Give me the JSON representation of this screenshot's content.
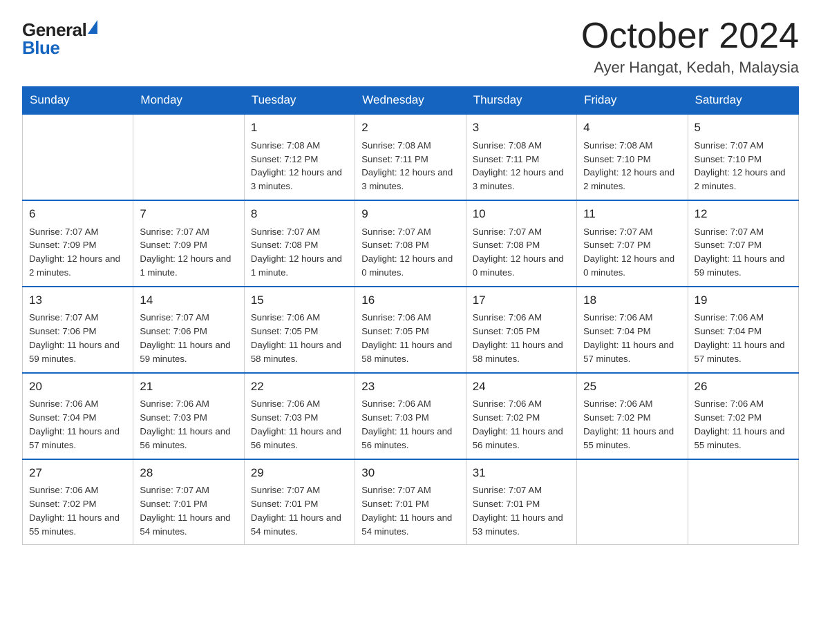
{
  "header": {
    "logo_general": "General",
    "logo_blue": "Blue",
    "month_title": "October 2024",
    "location": "Ayer Hangat, Kedah, Malaysia"
  },
  "days_of_week": [
    "Sunday",
    "Monday",
    "Tuesday",
    "Wednesday",
    "Thursday",
    "Friday",
    "Saturday"
  ],
  "weeks": [
    [
      {
        "day": "",
        "info": ""
      },
      {
        "day": "",
        "info": ""
      },
      {
        "day": "1",
        "info": "Sunrise: 7:08 AM\nSunset: 7:12 PM\nDaylight: 12 hours\nand 3 minutes."
      },
      {
        "day": "2",
        "info": "Sunrise: 7:08 AM\nSunset: 7:11 PM\nDaylight: 12 hours\nand 3 minutes."
      },
      {
        "day": "3",
        "info": "Sunrise: 7:08 AM\nSunset: 7:11 PM\nDaylight: 12 hours\nand 3 minutes."
      },
      {
        "day": "4",
        "info": "Sunrise: 7:08 AM\nSunset: 7:10 PM\nDaylight: 12 hours\nand 2 minutes."
      },
      {
        "day": "5",
        "info": "Sunrise: 7:07 AM\nSunset: 7:10 PM\nDaylight: 12 hours\nand 2 minutes."
      }
    ],
    [
      {
        "day": "6",
        "info": "Sunrise: 7:07 AM\nSunset: 7:09 PM\nDaylight: 12 hours\nand 2 minutes."
      },
      {
        "day": "7",
        "info": "Sunrise: 7:07 AM\nSunset: 7:09 PM\nDaylight: 12 hours\nand 1 minute."
      },
      {
        "day": "8",
        "info": "Sunrise: 7:07 AM\nSunset: 7:08 PM\nDaylight: 12 hours\nand 1 minute."
      },
      {
        "day": "9",
        "info": "Sunrise: 7:07 AM\nSunset: 7:08 PM\nDaylight: 12 hours\nand 0 minutes."
      },
      {
        "day": "10",
        "info": "Sunrise: 7:07 AM\nSunset: 7:08 PM\nDaylight: 12 hours\nand 0 minutes."
      },
      {
        "day": "11",
        "info": "Sunrise: 7:07 AM\nSunset: 7:07 PM\nDaylight: 12 hours\nand 0 minutes."
      },
      {
        "day": "12",
        "info": "Sunrise: 7:07 AM\nSunset: 7:07 PM\nDaylight: 11 hours\nand 59 minutes."
      }
    ],
    [
      {
        "day": "13",
        "info": "Sunrise: 7:07 AM\nSunset: 7:06 PM\nDaylight: 11 hours\nand 59 minutes."
      },
      {
        "day": "14",
        "info": "Sunrise: 7:07 AM\nSunset: 7:06 PM\nDaylight: 11 hours\nand 59 minutes."
      },
      {
        "day": "15",
        "info": "Sunrise: 7:06 AM\nSunset: 7:05 PM\nDaylight: 11 hours\nand 58 minutes."
      },
      {
        "day": "16",
        "info": "Sunrise: 7:06 AM\nSunset: 7:05 PM\nDaylight: 11 hours\nand 58 minutes."
      },
      {
        "day": "17",
        "info": "Sunrise: 7:06 AM\nSunset: 7:05 PM\nDaylight: 11 hours\nand 58 minutes."
      },
      {
        "day": "18",
        "info": "Sunrise: 7:06 AM\nSunset: 7:04 PM\nDaylight: 11 hours\nand 57 minutes."
      },
      {
        "day": "19",
        "info": "Sunrise: 7:06 AM\nSunset: 7:04 PM\nDaylight: 11 hours\nand 57 minutes."
      }
    ],
    [
      {
        "day": "20",
        "info": "Sunrise: 7:06 AM\nSunset: 7:04 PM\nDaylight: 11 hours\nand 57 minutes."
      },
      {
        "day": "21",
        "info": "Sunrise: 7:06 AM\nSunset: 7:03 PM\nDaylight: 11 hours\nand 56 minutes."
      },
      {
        "day": "22",
        "info": "Sunrise: 7:06 AM\nSunset: 7:03 PM\nDaylight: 11 hours\nand 56 minutes."
      },
      {
        "day": "23",
        "info": "Sunrise: 7:06 AM\nSunset: 7:03 PM\nDaylight: 11 hours\nand 56 minutes."
      },
      {
        "day": "24",
        "info": "Sunrise: 7:06 AM\nSunset: 7:02 PM\nDaylight: 11 hours\nand 56 minutes."
      },
      {
        "day": "25",
        "info": "Sunrise: 7:06 AM\nSunset: 7:02 PM\nDaylight: 11 hours\nand 55 minutes."
      },
      {
        "day": "26",
        "info": "Sunrise: 7:06 AM\nSunset: 7:02 PM\nDaylight: 11 hours\nand 55 minutes."
      }
    ],
    [
      {
        "day": "27",
        "info": "Sunrise: 7:06 AM\nSunset: 7:02 PM\nDaylight: 11 hours\nand 55 minutes."
      },
      {
        "day": "28",
        "info": "Sunrise: 7:07 AM\nSunset: 7:01 PM\nDaylight: 11 hours\nand 54 minutes."
      },
      {
        "day": "29",
        "info": "Sunrise: 7:07 AM\nSunset: 7:01 PM\nDaylight: 11 hours\nand 54 minutes."
      },
      {
        "day": "30",
        "info": "Sunrise: 7:07 AM\nSunset: 7:01 PM\nDaylight: 11 hours\nand 54 minutes."
      },
      {
        "day": "31",
        "info": "Sunrise: 7:07 AM\nSunset: 7:01 PM\nDaylight: 11 hours\nand 53 minutes."
      },
      {
        "day": "",
        "info": ""
      },
      {
        "day": "",
        "info": ""
      }
    ]
  ]
}
